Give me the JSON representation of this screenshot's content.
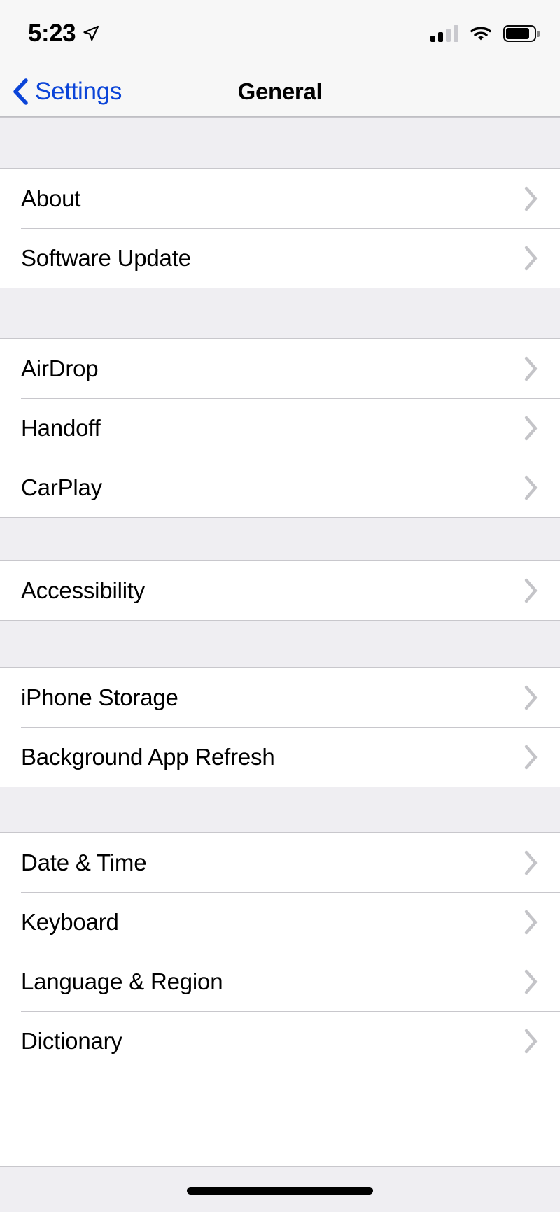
{
  "status_bar": {
    "time": "5:23",
    "location_icon": "location-arrow-icon",
    "cellular_icon": "cellular-signal-icon",
    "cellular_bars_filled": 2,
    "cellular_bars_total": 4,
    "wifi_icon": "wifi-icon",
    "battery_icon": "battery-icon",
    "battery_level_pct": 85
  },
  "nav_bar": {
    "back_label": "Settings",
    "back_icon": "chevron-left-icon",
    "title": "General"
  },
  "colors": {
    "accent_blue": "#0B44D8",
    "group_background": "#efeef2",
    "row_background": "#ffffff",
    "separator": "#c8c7cc",
    "chevron_gray": "#c4c4c8",
    "label_black": "#000000"
  },
  "sections": [
    {
      "id": "section-system",
      "rows": [
        {
          "label": "About",
          "accessory": "chevron-right-icon"
        },
        {
          "label": "Software Update",
          "accessory": "chevron-right-icon"
        }
      ]
    },
    {
      "id": "section-continuity",
      "rows": [
        {
          "label": "AirDrop",
          "accessory": "chevron-right-icon"
        },
        {
          "label": "Handoff",
          "accessory": "chevron-right-icon"
        },
        {
          "label": "CarPlay",
          "accessory": "chevron-right-icon"
        }
      ]
    },
    {
      "id": "section-accessibility",
      "rows": [
        {
          "label": "Accessibility",
          "accessory": "chevron-right-icon"
        }
      ]
    },
    {
      "id": "section-storage",
      "rows": [
        {
          "label": "iPhone Storage",
          "accessory": "chevron-right-icon"
        },
        {
          "label": "Background App Refresh",
          "accessory": "chevron-right-icon"
        }
      ]
    },
    {
      "id": "section-localization",
      "rows": [
        {
          "label": "Date & Time",
          "accessory": "chevron-right-icon"
        },
        {
          "label": "Keyboard",
          "accessory": "chevron-right-icon"
        },
        {
          "label": "Language & Region",
          "accessory": "chevron-right-icon"
        },
        {
          "label": "Dictionary",
          "accessory": "chevron-right-icon"
        }
      ]
    }
  ],
  "home_indicator": "home-indicator-bar"
}
